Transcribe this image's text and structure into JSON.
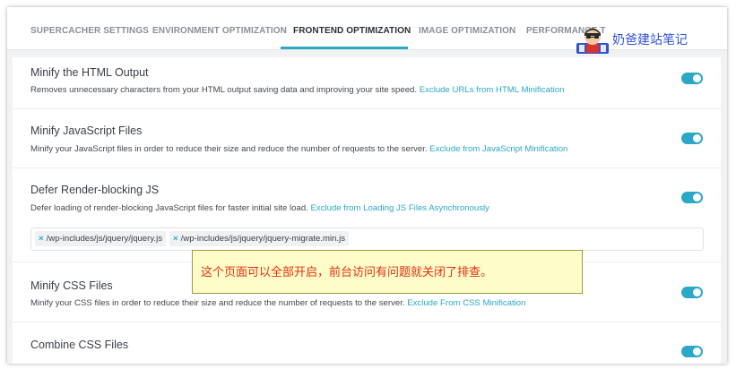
{
  "tabs": [
    {
      "label": "SUPERCACHER SETTINGS"
    },
    {
      "label": "ENVIRONMENT OPTIMIZATION"
    },
    {
      "label": "FRONTEND OPTIMIZATION"
    },
    {
      "label": "IMAGE OPTIMIZATION"
    },
    {
      "label": "PERFORMANCE T"
    }
  ],
  "active_tab": "FRONTEND OPTIMIZATION",
  "watermark": {
    "text": "奶爸建站笔记",
    "icon": "avatar-logo-icon"
  },
  "settings": [
    {
      "title": "Minify the HTML Output",
      "description": "Removes unnecessary characters from your HTML output saving data and improving your site speed.",
      "link": "Exclude URLs from HTML Minification",
      "enabled": true
    },
    {
      "title": "Minify JavaScript Files",
      "description": "Minify your JavaScript files in order to reduce their size and reduce the number of requests to the server.",
      "link": "Exclude from JavaScript Minification",
      "enabled": true
    },
    {
      "title": "Defer Render-blocking JS",
      "description": "Defer loading of render-blocking JavaScript files for faster initial site load.",
      "link": "Exclude from Loading JS Files Asynchronously",
      "enabled": true,
      "excluded": [
        "/wp-includes/js/jquery/jquery.js",
        "/wp-includes/js/jquery/jquery-migrate.min.js"
      ]
    },
    {
      "title": "Minify CSS Files",
      "description": "Minify your CSS files in order to reduce their size and reduce the number of requests to the server.",
      "link": "Exclude From CSS Minification",
      "enabled": true
    },
    {
      "title": "Combine CSS Files",
      "enabled": true
    }
  ],
  "annotation": "这个页面可以全部开启，前台访问有问题就关闭了排查。",
  "colors": {
    "accent": "#2aa8c6",
    "background": "#f1f2f4",
    "note_background": "#fefcc8",
    "note_text": "#e32f10",
    "watermark_text": "#2f53d6"
  }
}
